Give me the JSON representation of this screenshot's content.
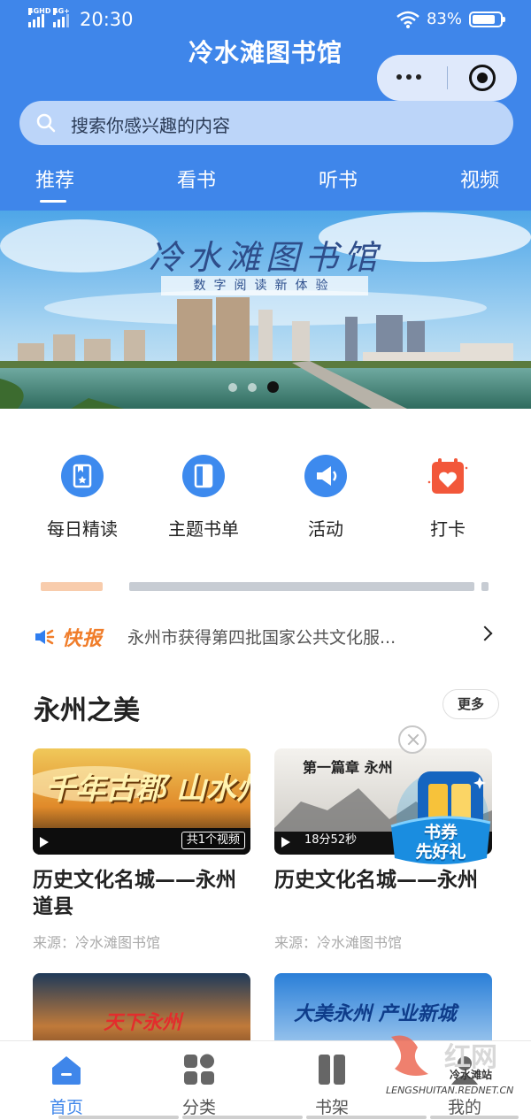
{
  "status_bar": {
    "network_1": "4G",
    "network_1_sup": "HD",
    "network_2": "4G",
    "network_2_sup": "+",
    "time": "20:30",
    "battery": "83%",
    "battery_level": 0.83
  },
  "header": {
    "title": "冷水滩图书馆",
    "search_placeholder": "搜索你感兴趣的内容"
  },
  "tabs": [
    {
      "label": "推荐",
      "active": true
    },
    {
      "label": "看书",
      "active": false
    },
    {
      "label": "听书",
      "active": false
    },
    {
      "label": "视频",
      "active": false
    }
  ],
  "banner": {
    "title": "冷水滩图书馆",
    "subtitle": "数字阅读新体验",
    "slide_count": 3,
    "active_slide": 2
  },
  "quick_entries": [
    {
      "label": "每日精读",
      "icon": "bookmark-star-icon"
    },
    {
      "label": "主题书单",
      "icon": "book-icon"
    },
    {
      "label": "活动",
      "icon": "megaphone-icon"
    },
    {
      "label": "打卡",
      "icon": "calendar-heart-icon"
    }
  ],
  "news": {
    "badge": "快报",
    "text": "永州市获得第四批国家公共文化服..."
  },
  "section": {
    "title": "永州之美",
    "more_label": "更多"
  },
  "cards": [
    {
      "thumb_text": "千年古郡 山水州城",
      "badge": "共1个视频",
      "title": "历史文化名城——永州道县",
      "source": "来源：冷水滩图书馆"
    },
    {
      "thumb_text": "第一篇章 永州",
      "duration": "18分52秒",
      "title": "历史文化名城——永州",
      "source": "来源：冷水滩图书馆"
    },
    {
      "thumb_text": "天下永州"
    },
    {
      "thumb_text": "大美永州 产业新城"
    }
  ],
  "promo": {
    "text_line1": "书券",
    "text_line2": "先好礼"
  },
  "bottom_nav": [
    {
      "label": "首页",
      "icon": "home-icon",
      "active": true
    },
    {
      "label": "分类",
      "icon": "category-icon",
      "active": false
    },
    {
      "label": "书架",
      "icon": "bookshelf-icon",
      "active": false
    },
    {
      "label": "我的",
      "icon": "profile-icon",
      "active": false
    }
  ],
  "watermark": {
    "logo": "红网",
    "site": "冷水滩站",
    "url": "LENGSHUITAN.REDNET.CN"
  },
  "colors": {
    "primary": "#3f86ea",
    "accent_orange": "#f07d2a",
    "text_dark": "#222222",
    "text_muted": "#aaaaaa"
  }
}
